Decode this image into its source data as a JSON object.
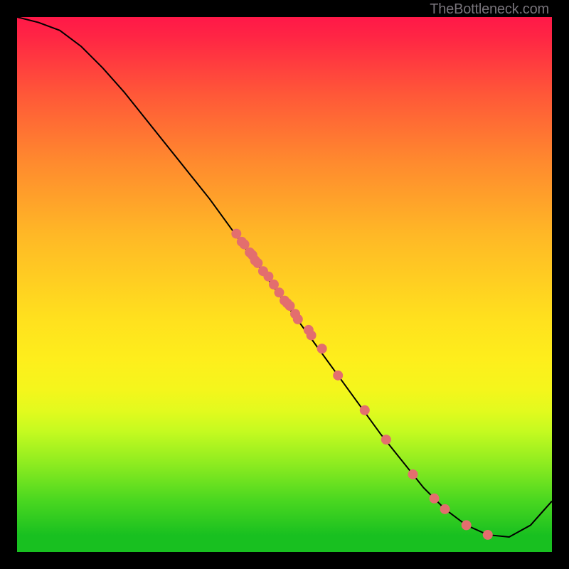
{
  "attribution": "TheBottleneck.com",
  "chart_data": {
    "type": "line",
    "title": "",
    "xlabel": "",
    "ylabel": "",
    "xlim": [
      0,
      100
    ],
    "ylim": [
      0,
      100
    ],
    "grid": false,
    "legend": false,
    "line": {
      "x": [
        0,
        4,
        8,
        12,
        16,
        20,
        24,
        28,
        32,
        36,
        40,
        44,
        48,
        52,
        56,
        60,
        64,
        68,
        72,
        76,
        80,
        84,
        88,
        92,
        96,
        100
      ],
      "y": [
        100,
        99,
        97.5,
        94.5,
        90.5,
        86,
        81,
        76,
        71,
        66,
        60.5,
        55,
        49.5,
        44,
        38.5,
        33,
        27.5,
        22,
        17,
        12,
        8,
        5,
        3.2,
        2.8,
        5,
        9.5
      ],
      "color": "#000000"
    },
    "points": {
      "x": [
        41,
        42,
        42.5,
        43.5,
        44,
        44.5,
        45,
        46,
        47,
        48,
        49,
        50,
        50.5,
        51,
        52,
        52.5,
        54.5,
        55,
        57,
        60,
        65,
        69,
        74,
        78,
        80,
        84,
        88
      ],
      "y": [
        59.5,
        58,
        57.5,
        56,
        55.5,
        54.5,
        54,
        52.5,
        51.5,
        50,
        48.5,
        47,
        46.5,
        46,
        44.5,
        43.5,
        41.5,
        40.5,
        38,
        33,
        26.5,
        21,
        14.5,
        10,
        8,
        5,
        3.2
      ],
      "color": "#e36e6e",
      "size": 7
    },
    "background_gradient": {
      "type": "vertical",
      "stops": [
        {
          "y": 100,
          "color": "#ff1848"
        },
        {
          "y": 50,
          "color": "#ffe01e"
        },
        {
          "y": 15,
          "color": "#e2fa1e"
        },
        {
          "y": 3,
          "color": "#18c020"
        },
        {
          "y": 0,
          "color": "#18c020"
        }
      ]
    }
  }
}
